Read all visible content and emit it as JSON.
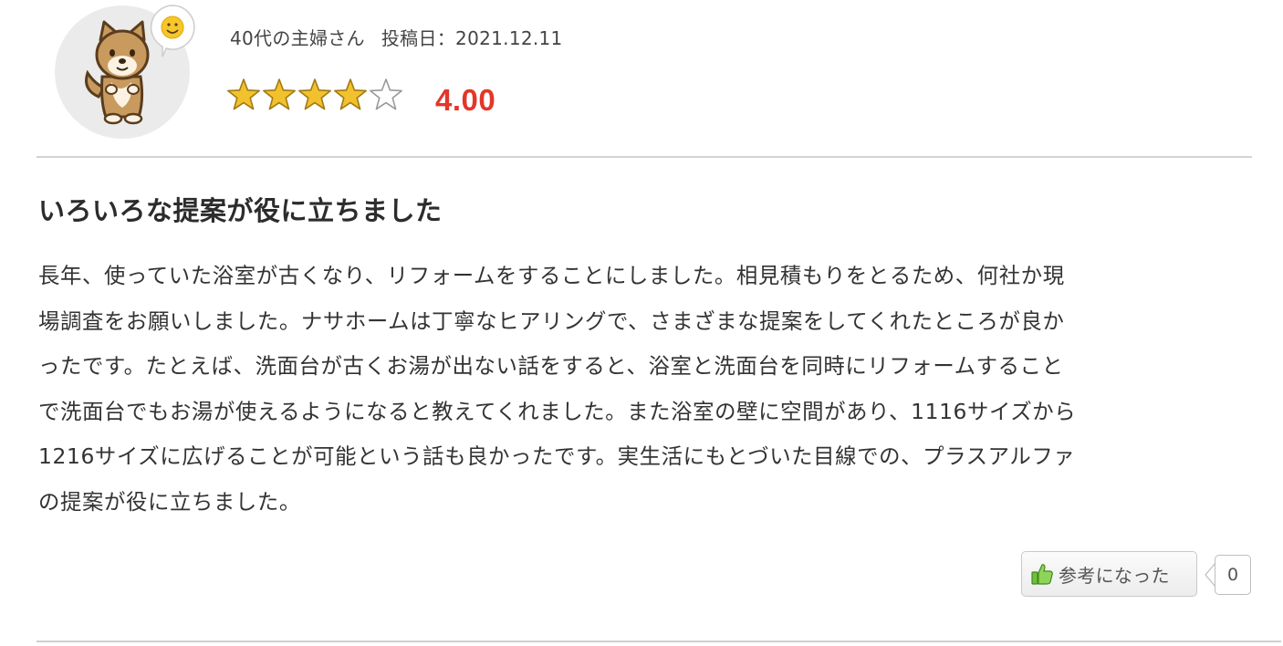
{
  "reviewer": {
    "name": "40代の主婦さん",
    "date_label": "投稿日：2021.12.11",
    "avatar_icon": "shiba-dog-mascot-icon",
    "bubble_icon": "smiley-face-icon"
  },
  "rating": {
    "value": 4,
    "max": 5,
    "score_text": "4.00",
    "star_color": "#f2c12e",
    "score_color": "#e2372a"
  },
  "review": {
    "title": "いろいろな提案が役に立ちました",
    "body_lines": [
      "長年、使っていた浴室が古くなり、リフォームをすることにしました。相見積もりをとるため、何社か現",
      "場調査をお願いしました。ナサホームは丁寧なヒアリングで、さまざまな提案をしてくれたところが良か",
      "ったです。たとえば、洗面台が古くお湯が出ない話をすると、浴室と洗面台を同時にリフォームすること",
      "で洗面台でもお湯が使えるようになると教えてくれました。また浴室の壁に空間があり、1116サイズから",
      "1216サイズに広げることが可能という話も良かったです。実生活にもとづいた目線での、プラスアルファ",
      "の提案が役に立ちました。"
    ]
  },
  "helpful": {
    "label": "参考になった",
    "icon": "thumbs-up-icon",
    "count": "0"
  }
}
